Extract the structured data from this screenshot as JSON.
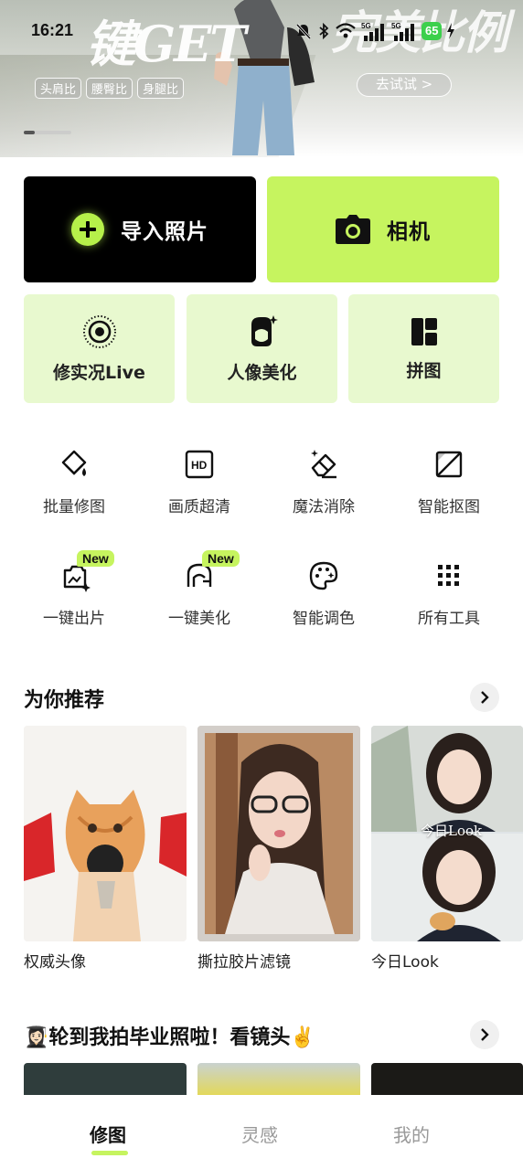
{
  "status_bar": {
    "time": "16:21",
    "battery": "65",
    "network_1": "5G",
    "network_2": "5G"
  },
  "banner": {
    "hero_left": "键GET",
    "hero_right": "完美比例",
    "tags": [
      "头肩比",
      "腰臀比",
      "身腿比"
    ],
    "try_button": "去试试 >"
  },
  "primary_actions": {
    "import_label": "导入照片",
    "camera_label": "相机"
  },
  "feature_cards": [
    {
      "label": "修实况Live",
      "icon": "live-photo-icon"
    },
    {
      "label": "人像美化",
      "icon": "portrait-beauty-icon"
    },
    {
      "label": "拼图",
      "icon": "collage-icon"
    }
  ],
  "tools": [
    {
      "label": "批量修图",
      "icon": "batch-edit-icon"
    },
    {
      "label": "画质超清",
      "icon": "hd-icon"
    },
    {
      "label": "魔法消除",
      "icon": "magic-eraser-icon"
    },
    {
      "label": "智能抠图",
      "icon": "smart-cutout-icon"
    },
    {
      "label": "一键出片",
      "icon": "one-click-photo-icon",
      "badge": "New"
    },
    {
      "label": "一键美化",
      "icon": "one-click-beauty-icon",
      "badge": "New"
    },
    {
      "label": "智能调色",
      "icon": "color-palette-icon"
    },
    {
      "label": "所有工具",
      "icon": "all-tools-grid-icon"
    }
  ],
  "recommend": {
    "title": "为你推荐",
    "items": [
      {
        "label": "权威头像"
      },
      {
        "label": "撕拉胶片滤镜"
      },
      {
        "label": "今日Look",
        "overlay": "今日Look"
      }
    ]
  },
  "graduation": {
    "title": "👩🏻‍🎓轮到我拍毕业照啦！看镜头✌️"
  },
  "tabs": [
    {
      "label": "修图",
      "active": true
    },
    {
      "label": "灵感",
      "active": false
    },
    {
      "label": "我的",
      "active": false
    }
  ],
  "colors": {
    "accent": "#c6f45f",
    "card_bg": "#e8f9cf",
    "dark": "#000000"
  }
}
